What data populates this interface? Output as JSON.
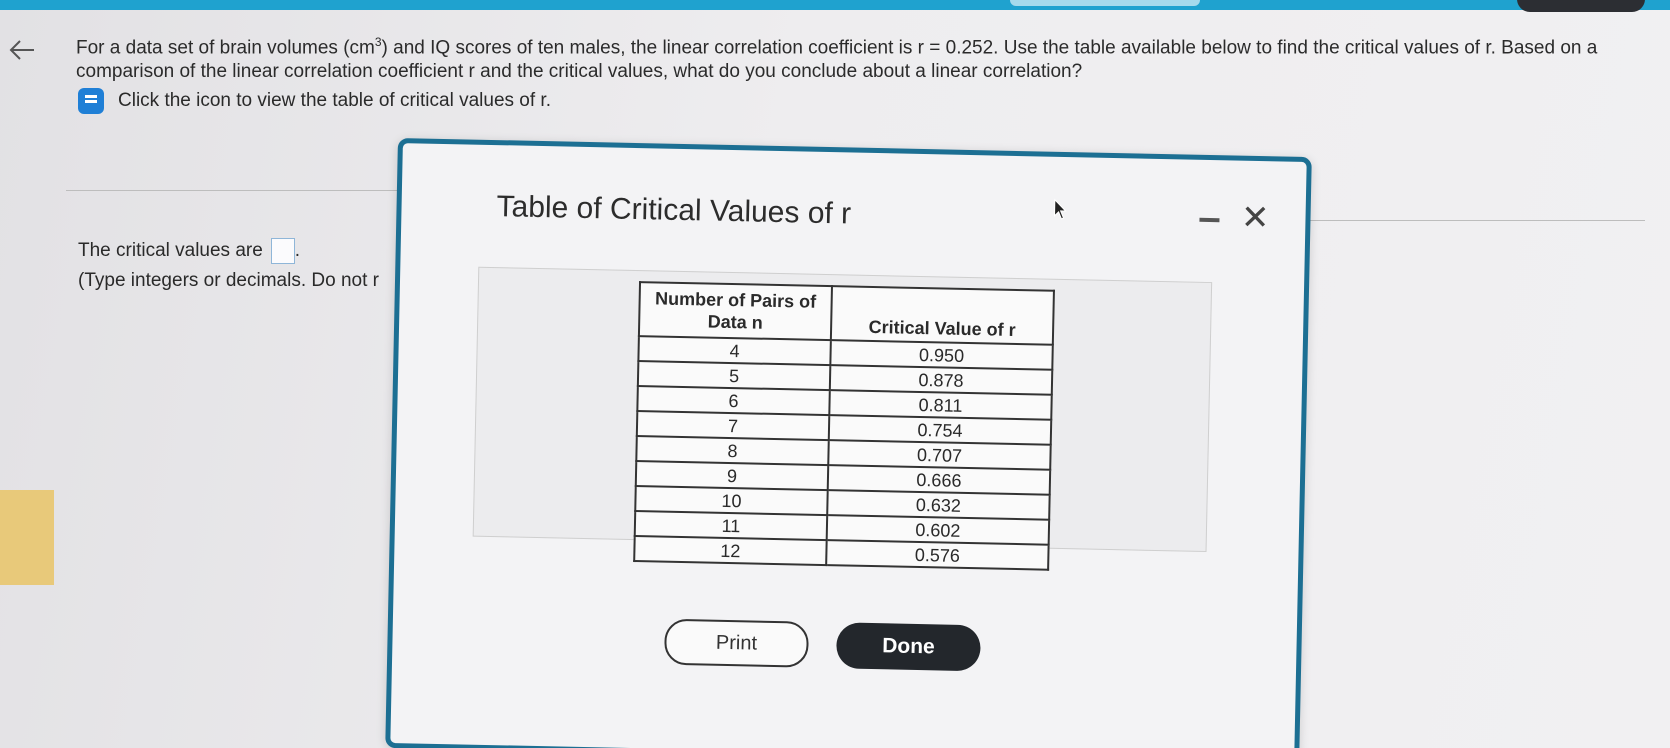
{
  "question": {
    "text_part1": "For a data set of brain volumes (cm",
    "superscript": "3",
    "text_part2": ") and IQ scores of ten males, the linear correlation coefficient is r = 0.252. Use the table available below to find the critical values of r. Based on a comparison of the linear correlation coefficient r and the critical values, what do you conclude about a linear correlation?",
    "hint": "Click the icon to view the table of critical values of r."
  },
  "answer": {
    "prompt": "The critical values are",
    "note": "(Type integers or decimals. Do not r"
  },
  "modal": {
    "title": "Table of Critical Values of r",
    "close_label": "✕",
    "table": {
      "header_col1": "Number of Pairs of Data n",
      "header_col2": "Critical Value of r",
      "rows": [
        {
          "n": "4",
          "r": "0.950"
        },
        {
          "n": "5",
          "r": "0.878"
        },
        {
          "n": "6",
          "r": "0.811"
        },
        {
          "n": "7",
          "r": "0.754"
        },
        {
          "n": "8",
          "r": "0.707"
        },
        {
          "n": "9",
          "r": "0.666"
        },
        {
          "n": "10",
          "r": "0.632"
        },
        {
          "n": "11",
          "r": "0.602"
        },
        {
          "n": "12",
          "r": "0.576"
        }
      ]
    },
    "print_label": "Print",
    "done_label": "Done"
  },
  "colors": {
    "top_bar": "#1fa2cf",
    "modal_border": "#1c6f93",
    "done_button": "#23272c",
    "book_icon": "#1f7fd6"
  }
}
